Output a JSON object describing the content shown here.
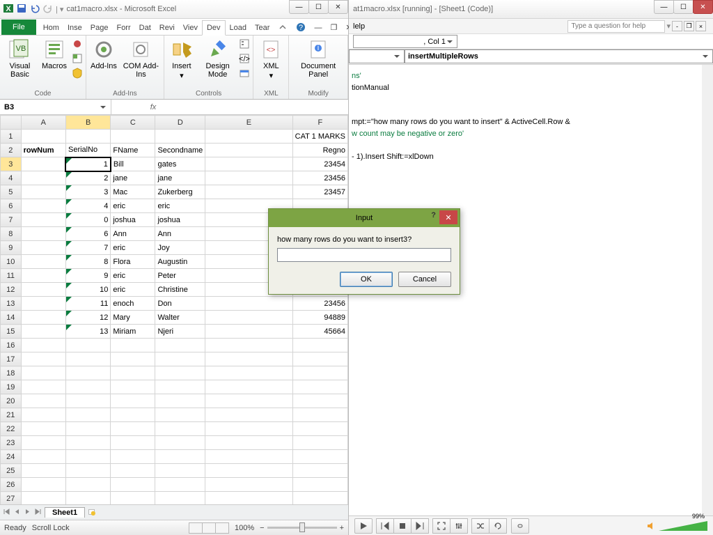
{
  "excel": {
    "title": "cat1macro.xlsx - Microsoft Excel",
    "namebox": "B3",
    "tabs": {
      "file": "File",
      "home": "Hom",
      "insert": "Inse",
      "page": "Page",
      "form": "Forr",
      "data": "Dat",
      "review": "Revi",
      "view": "Viev",
      "dev": "Dev",
      "load": "Load",
      "team": "Tear"
    },
    "groups": {
      "code": "Code",
      "addins": "Add-Ins",
      "controls": "Controls",
      "xml": "XML",
      "modify": "Modify"
    },
    "btns": {
      "vb": "Visual Basic",
      "macros": "Macros",
      "addins": "Add-Ins",
      "com": "COM Add-Ins",
      "insert": "Insert",
      "design": "Design Mode",
      "xml": "XML",
      "docpanel": "Document Panel"
    },
    "headers": {
      "title": "CAT 1 MARKS",
      "rownum": "rowNum",
      "serial": "SerialNo",
      "fname": "FName",
      "second": "Secondname",
      "regno": "Regno"
    },
    "rows": [
      {
        "s": "1",
        "f": "Bill",
        "l": "gates",
        "r": "23454"
      },
      {
        "s": "2",
        "f": "jane",
        "l": "jane",
        "r": "23456"
      },
      {
        "s": "3",
        "f": "Mac",
        "l": "Zukerberg",
        "r": "23457"
      },
      {
        "s": "4",
        "f": "eric",
        "l": "eric",
        "r": ""
      },
      {
        "s": "0",
        "f": "joshua",
        "l": "joshua",
        "r": ""
      },
      {
        "s": "6",
        "f": "Ann",
        "l": "Ann",
        "r": ""
      },
      {
        "s": "7",
        "f": "eric",
        "l": "Joy",
        "r": ""
      },
      {
        "s": "8",
        "f": "Flora",
        "l": "Augustin",
        "r": ""
      },
      {
        "s": "9",
        "f": "eric",
        "l": "Peter",
        "r": ""
      },
      {
        "s": "10",
        "f": "eric",
        "l": "Christine",
        "r": ""
      },
      {
        "s": "11",
        "f": "enoch",
        "l": "Don",
        "r": "23456"
      },
      {
        "s": "12",
        "f": "Mary",
        "l": "Walter",
        "r": "94889"
      },
      {
        "s": "13",
        "f": "Miriam",
        "l": "Njeri",
        "r": "45664"
      }
    ],
    "sheet": "Sheet1",
    "status": {
      "ready": "Ready",
      "scroll": "Scroll Lock",
      "zoom": "100%"
    }
  },
  "vbe": {
    "title": "at1macro.xlsx [running] - [Sheet1 (Code)]",
    "menu": "lelp",
    "ask": "Type a question for help",
    "loc": ", Col 1",
    "proc": "insertMultipleRows",
    "code": {
      "l1": "ns'",
      "l2": "tionManual",
      "l3": "mpt:=\"how many rows do you want to insert\" & ActiveCell.Row &",
      "l4": "w count may be negative or zero'",
      "l5": " - 1).Insert Shift:=xlDown"
    },
    "vol": "99%"
  },
  "dialog": {
    "title": "Input",
    "prompt": "how many rows do you want to insert3?",
    "ok": "OK",
    "cancel": "Cancel"
  }
}
